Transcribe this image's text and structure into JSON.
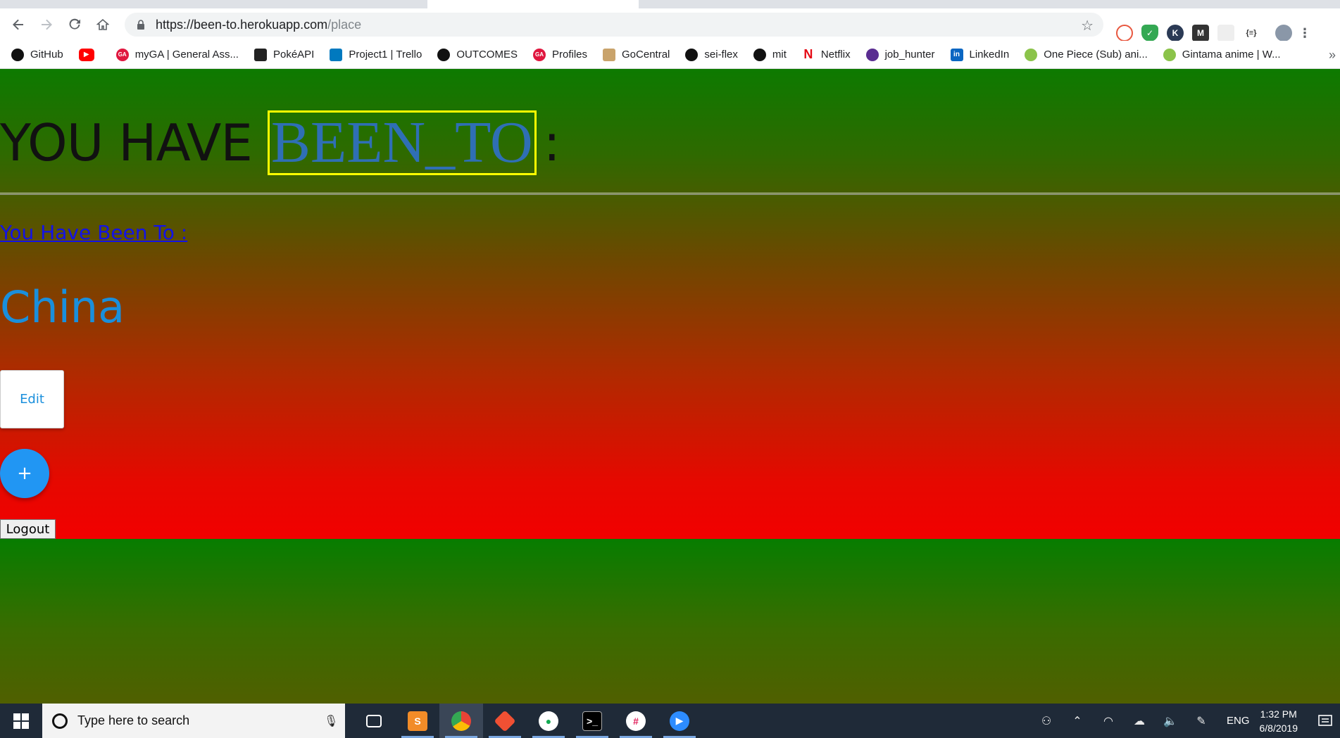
{
  "browser": {
    "url_host": "https://been-to.herokuapp.com",
    "url_path": "/place",
    "bookmarks": [
      {
        "label": "GitHub",
        "icon": "github-icon",
        "color": "#111111"
      },
      {
        "label": "",
        "icon": "youtube-icon",
        "color": "#ff0000"
      },
      {
        "label": "myGA | General Ass...",
        "icon": "ga-icon",
        "color": "#e0173f"
      },
      {
        "label": "PokéAPI",
        "icon": "pokeapi-icon",
        "color": "#222222"
      },
      {
        "label": "Project1 | Trello",
        "icon": "trello-icon",
        "color": "#0079bf"
      },
      {
        "label": "OUTCOMES",
        "icon": "github-icon",
        "color": "#111111"
      },
      {
        "label": "Profiles",
        "icon": "ga-icon",
        "color": "#e0173f"
      },
      {
        "label": "GoCentral",
        "icon": "gocentral-icon",
        "color": "#c9a36b"
      },
      {
        "label": "sei-flex",
        "icon": "github-icon",
        "color": "#111111"
      },
      {
        "label": "mit",
        "icon": "github-icon",
        "color": "#111111"
      },
      {
        "label": "Netflix",
        "icon": "netflix-icon",
        "color": "#e50914"
      },
      {
        "label": "job_hunter",
        "icon": "jobhunter-icon",
        "color": "#5a2d91"
      },
      {
        "label": "LinkedIn",
        "icon": "linkedin-icon",
        "color": "#0a66c2"
      },
      {
        "label": "One Piece (Sub) ani...",
        "icon": "anime-icon",
        "color": "#8bc34a"
      },
      {
        "label": "Gintama anime | W...",
        "icon": "anime-icon",
        "color": "#8bc34a"
      }
    ]
  },
  "page": {
    "heading_prefix": "YOU HAVE",
    "heading_brand": "BEEN_TO",
    "heading_suffix": ":",
    "sub_link": "You Have Been To :",
    "place_name": "China",
    "edit_label": "Edit",
    "add_label": "+",
    "logout_label": "Logout"
  },
  "taskbar": {
    "search_placeholder": "Type here to search",
    "language": "ENG",
    "time": "1:32 PM",
    "date": "6/8/2019"
  }
}
